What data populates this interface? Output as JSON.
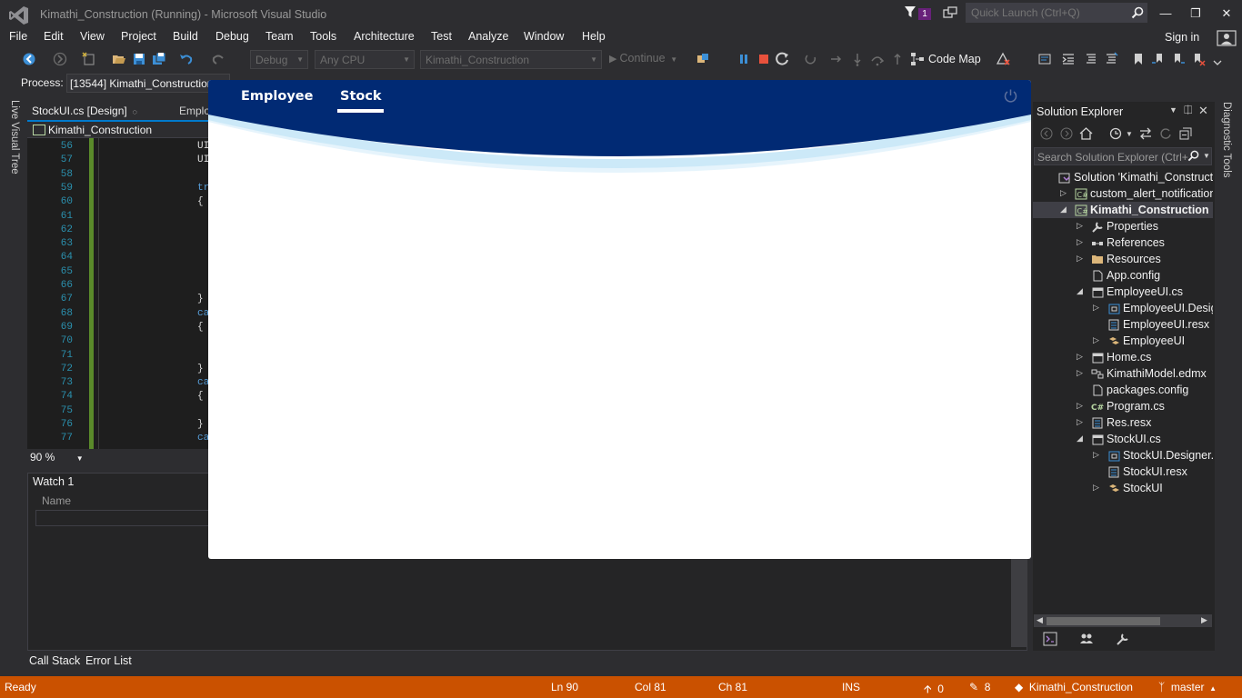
{
  "window": {
    "title": "Kimathi_Construction (Running) - Microsoft Visual Studio",
    "notification_count": "1",
    "quick_launch_placeholder": "Quick Launch (Ctrl+Q)"
  },
  "menu": {
    "items": [
      "File",
      "Edit",
      "View",
      "Project",
      "Build",
      "Debug",
      "Team",
      "Tools",
      "Architecture",
      "Test",
      "Analyze",
      "Window",
      "Help"
    ],
    "sign_in": "Sign in"
  },
  "toolbar": {
    "configuration": "Debug",
    "platform": "Any CPU",
    "startup_project": "Kimathi_Construction",
    "continue_label": "Continue",
    "code_map_label": "Code Map"
  },
  "process": {
    "label": "Process:",
    "value": "[13544] Kimathi_Construction"
  },
  "left_strip": {
    "label": "Live Visual Tree"
  },
  "editor": {
    "tabs": [
      "StockUI.cs [Design]",
      "Emplo"
    ],
    "active_tab_pin": "🔒",
    "nav_project": "Kimathi_Construction",
    "lines": [
      {
        "n": "56",
        "code": "UI",
        "kw": false
      },
      {
        "n": "57",
        "code": "UI",
        "kw": false
      },
      {
        "n": "58",
        "code": "",
        "kw": false
      },
      {
        "n": "59",
        "code": "tr",
        "kw": true
      },
      {
        "n": "60",
        "code": "{",
        "kw": false
      },
      {
        "n": "61",
        "code": "",
        "kw": false
      },
      {
        "n": "62",
        "code": "",
        "kw": false
      },
      {
        "n": "63",
        "code": "",
        "kw": false
      },
      {
        "n": "64",
        "code": "",
        "kw": false
      },
      {
        "n": "65",
        "code": "",
        "kw": false
      },
      {
        "n": "66",
        "code": "",
        "kw": false
      },
      {
        "n": "67",
        "code": "}",
        "kw": false
      },
      {
        "n": "68",
        "code": "ca",
        "kw": true
      },
      {
        "n": "69",
        "code": "{",
        "kw": false
      },
      {
        "n": "70",
        "code": "",
        "kw": false
      },
      {
        "n": "71",
        "code": "",
        "kw": false
      },
      {
        "n": "72",
        "code": "}",
        "kw": false
      },
      {
        "n": "73",
        "code": "ca",
        "kw": true
      },
      {
        "n": "74",
        "code": "{",
        "kw": false
      },
      {
        "n": "75",
        "code": "",
        "kw": false
      },
      {
        "n": "76",
        "code": "}",
        "kw": false
      },
      {
        "n": "77",
        "code": "ca",
        "kw": true
      }
    ],
    "zoom": "90 %"
  },
  "watch": {
    "title": "Watch 1",
    "column_name": "Name"
  },
  "bottom_tabs": [
    "Call Stack",
    "Error List"
  ],
  "app": {
    "tabs": [
      "Employee",
      "Stock"
    ],
    "active_tab": "Stock",
    "header_color": "#012a74"
  },
  "solution_explorer": {
    "title": "Solution Explorer",
    "search_placeholder": "Search Solution Explorer (Ctrl+",
    "items": [
      {
        "label": "Solution 'Kimathi_Construction",
        "indent": 0,
        "arrow": "",
        "icon": "solution-icon",
        "selected": false
      },
      {
        "label": "custom_alert_notifications",
        "indent": 1,
        "arrow": "▷",
        "icon": "csharp-project-icon",
        "selected": false
      },
      {
        "label": "Kimathi_Construction",
        "indent": 1,
        "arrow": "◢",
        "icon": "csharp-project-icon",
        "selected": true
      },
      {
        "label": "Properties",
        "indent": 2,
        "arrow": "▷",
        "icon": "wrench-icon",
        "selected": false
      },
      {
        "label": "References",
        "indent": 2,
        "arrow": "▷",
        "icon": "references-icon",
        "selected": false
      },
      {
        "label": "Resources",
        "indent": 2,
        "arrow": "▷",
        "icon": "folder-icon",
        "selected": false
      },
      {
        "label": "App.config",
        "indent": 2,
        "arrow": "",
        "icon": "config-file-icon",
        "selected": false
      },
      {
        "label": "EmployeeUI.cs",
        "indent": 2,
        "arrow": "◢",
        "icon": "form-icon",
        "selected": false
      },
      {
        "label": "EmployeeUI.Designer",
        "indent": 3,
        "arrow": "▷",
        "icon": "designer-file-icon",
        "selected": false
      },
      {
        "label": "EmployeeUI.resx",
        "indent": 3,
        "arrow": "",
        "icon": "resx-file-icon",
        "selected": false
      },
      {
        "label": "EmployeeUI",
        "indent": 3,
        "arrow": "▷",
        "icon": "class-icon",
        "selected": false
      },
      {
        "label": "Home.cs",
        "indent": 2,
        "arrow": "▷",
        "icon": "form-icon",
        "selected": false
      },
      {
        "label": "KimathiModel.edmx",
        "indent": 2,
        "arrow": "▷",
        "icon": "edmx-icon",
        "selected": false
      },
      {
        "label": "packages.config",
        "indent": 2,
        "arrow": "",
        "icon": "config-file-icon",
        "selected": false
      },
      {
        "label": "Program.cs",
        "indent": 2,
        "arrow": "▷",
        "icon": "csharp-file-icon",
        "selected": false
      },
      {
        "label": "Res.resx",
        "indent": 2,
        "arrow": "▷",
        "icon": "resx-file-icon",
        "selected": false
      },
      {
        "label": "StockUI.cs",
        "indent": 2,
        "arrow": "◢",
        "icon": "form-icon",
        "selected": false
      },
      {
        "label": "StockUI.Designer.cs",
        "indent": 3,
        "arrow": "▷",
        "icon": "designer-file-icon",
        "selected": false
      },
      {
        "label": "StockUI.resx",
        "indent": 3,
        "arrow": "",
        "icon": "resx-file-icon",
        "selected": false
      },
      {
        "label": "StockUI",
        "indent": 3,
        "arrow": "▷",
        "icon": "class-icon",
        "selected": false
      }
    ]
  },
  "right_strip": {
    "label": "Diagnostic Tools"
  },
  "status": {
    "ready": "Ready",
    "ln": "Ln 90",
    "col": "Col 81",
    "ch": "Ch 81",
    "ins": "INS",
    "up_count": "0",
    "edit_count": "8",
    "repo": "Kimathi_Construction",
    "branch": "master",
    "bar_color": "#ca5100"
  }
}
